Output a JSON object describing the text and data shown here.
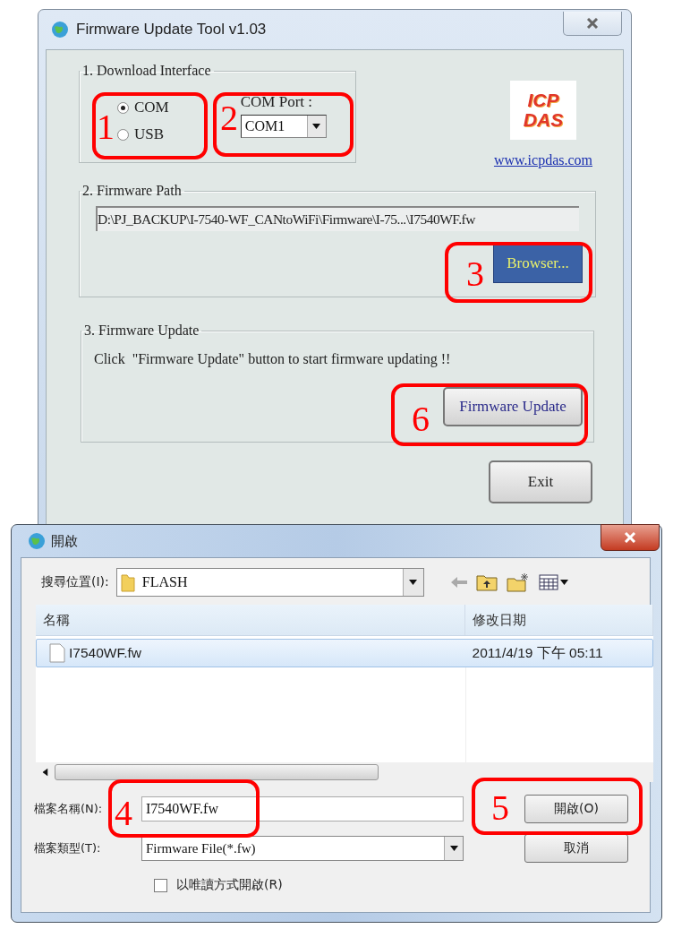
{
  "tool_window": {
    "title": "Firmware Update Tool v1.03",
    "download_interface": {
      "title": "1. Download Interface",
      "options": [
        {
          "label": "COM",
          "selected": true
        },
        {
          "label": "USB",
          "selected": false
        }
      ],
      "port_label": "COM Port :",
      "port_value": "COM1"
    },
    "logo": {
      "lines": [
        "ICP",
        "DAS"
      ]
    },
    "link": "www.icpdas.com",
    "firmware_path": {
      "title": "2. Firmware Path",
      "path": "D:\\PJ_BACKUP\\I-7540-WF_CANtoWiFi\\Firmware\\I-75...\\I7540WF.fw",
      "button": "Browser..."
    },
    "firmware_update": {
      "title": "3. Firmware Update",
      "message": "Click  \"Firmware Update\" button to start firmware updating !!",
      "button": "Firmware Update"
    },
    "exit_button": "Exit"
  },
  "open_dialog": {
    "title": "開啟",
    "look_in_label": "搜尋位置(I):",
    "look_in_value": "FLASH",
    "columns": [
      "名稱",
      "修改日期"
    ],
    "files": [
      {
        "name": "I7540WF.fw",
        "modified": "2011/4/19 下午 05:11",
        "selected": true
      }
    ],
    "file_name_label": "檔案名稱(N):",
    "file_name_value": "I7540WF.fw",
    "file_type_label": "檔案類型(T):",
    "file_type_value": "Firmware File(*.fw)",
    "open_button": "開啟(O)",
    "cancel_button": "取消",
    "read_only": {
      "label": "以唯讀方式開啟(R)",
      "checked": false
    }
  },
  "annotations": [
    {
      "number": "1"
    },
    {
      "number": "2"
    },
    {
      "number": "3"
    },
    {
      "number": "6"
    },
    {
      "number": "4"
    },
    {
      "number": "5"
    }
  ]
}
